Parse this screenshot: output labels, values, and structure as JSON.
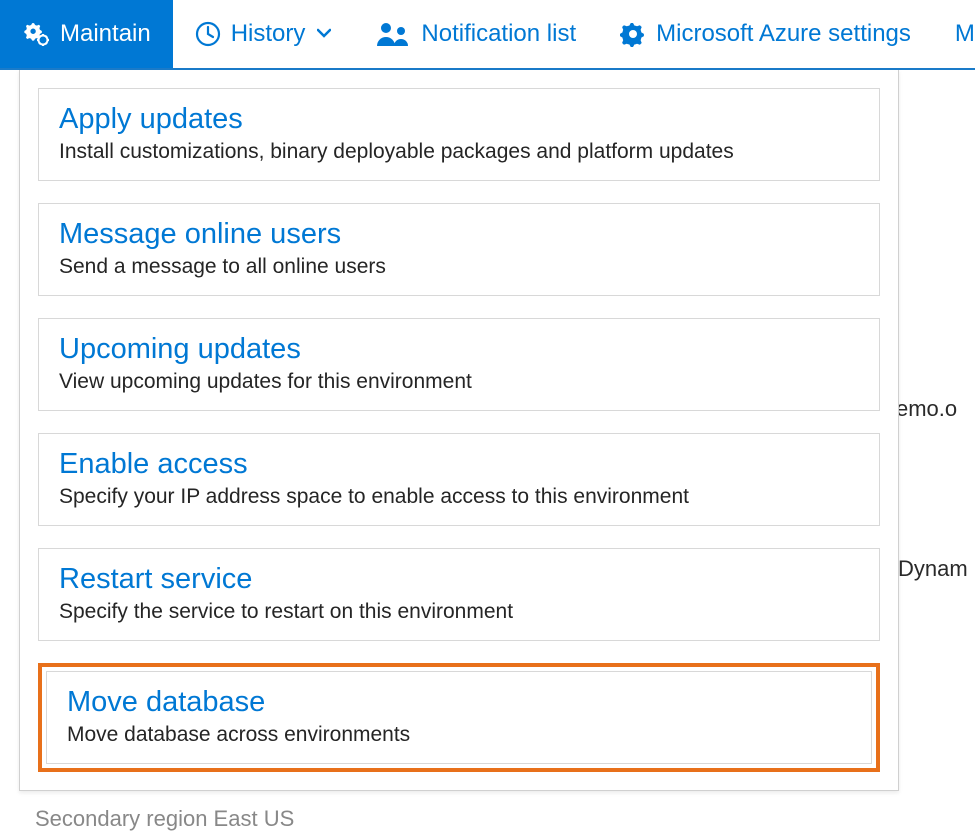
{
  "toolbar": {
    "maintain": "Maintain",
    "history": "History",
    "notification_list": "Notification list",
    "azure_settings": "Microsoft Azure settings",
    "more_cut": "Mi"
  },
  "menu": [
    {
      "title": "Apply updates",
      "desc": "Install customizations, binary deployable packages and platform updates"
    },
    {
      "title": "Message online users",
      "desc": "Send a message to all online users"
    },
    {
      "title": "Upcoming updates",
      "desc": "View upcoming updates for this environment"
    },
    {
      "title": "Enable access",
      "desc": "Specify your IP address space to enable access to this environment"
    },
    {
      "title": "Restart service",
      "desc": "Specify the service to restart on this environment"
    },
    {
      "title": "Move database",
      "desc": "Move database across environments"
    }
  ],
  "background": {
    "text1": "emo.o",
    "text2": "Dynam",
    "text3": "Secondary region   East US"
  }
}
